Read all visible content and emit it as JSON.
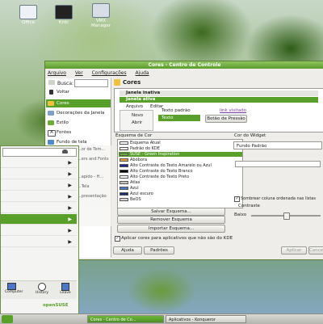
{
  "desktop": {
    "icons": [
      {
        "label": "Office",
        "icon": "office-icon"
      },
      {
        "label": "Krdc",
        "icon": "krdc-icon"
      },
      {
        "label": "VMX Manager",
        "icon": "vmx-manager-icon"
      }
    ]
  },
  "control_center": {
    "title": "Cores - Centro de Controle",
    "menu": [
      "Arquivo",
      "Ver",
      "Configurações",
      "Ajuda"
    ],
    "search_label": "Busca:",
    "search_value": "",
    "back_label": "Voltar",
    "sidebar": [
      {
        "label": "Cores",
        "icon": "palette-icon",
        "selected": true
      },
      {
        "label": "Decorações da Janela",
        "icon": "window-decoration-icon",
        "selected": false
      },
      {
        "label": "Estilo",
        "icon": "style-icon",
        "selected": false
      },
      {
        "label": "Fontes",
        "icon": "fonts-icon",
        "selected": false
      },
      {
        "label": "Fundo de tela",
        "icon": "wallpaper-icon",
        "selected": false
      }
    ],
    "section_title": "Cores",
    "preview": {
      "inactive_window": "Janela inativa",
      "active_window": "Janela ativa",
      "menu": [
        "Arquivo",
        "Editar"
      ],
      "menu_items": [
        "Novo",
        "Abrir"
      ],
      "normal_text": "Texto padrão",
      "visited_link": "link visitado",
      "selected_text": "Texto selecionado",
      "button": "Botão de Pressão"
    },
    "scheme_title": "Esquema de Cor",
    "schemes": [
      {
        "label": "Esquema Atual",
        "selected": false
      },
      {
        "label": "Padrão do KDE",
        "selected": false
      },
      {
        "label": "SUSE - Green Inspiration",
        "selected": true
      },
      {
        "label": "Abóbora",
        "selected": false
      },
      {
        "label": "Alto Contraste do Texto Amarelo ou Azul",
        "selected": false
      },
      {
        "label": "Alto Contraste do Texto Branco",
        "selected": false
      },
      {
        "label": "Alto Contraste do Texto Preto",
        "selected": false
      },
      {
        "label": "Atlas",
        "selected": false
      },
      {
        "label": "Azul",
        "selected": false
      },
      {
        "label": "Azul escuro",
        "selected": false
      },
      {
        "label": "BeOS",
        "selected": false
      }
    ],
    "buttons": [
      "Salvar Esquema...",
      "Remover Esquema",
      "Importar Esquema..."
    ],
    "widget_color_title": "Cor do Widget",
    "widget_color_value": "Fundo Padrão",
    "shade_checkbox": "Sombrear coluna ordenada nas listas",
    "contrast_title": "Contraste",
    "contrast_low": "Baixo",
    "contrast_level": 0.5,
    "apply_non_kde": "Aplicar cores para aplicativos que não são do KDE",
    "help_button": "Ajuda",
    "defaults_button": "Padrões",
    "apply_button": "Aplicar",
    "cancel_button": "Cancelar"
  },
  "background_window": {
    "items": [
      "...or de Tem...",
      "...ers and Fonts",
      "...apido - H...",
      "...Tela",
      "...presentação"
    ]
  },
  "start_menu": {
    "row_count": 8,
    "selected_row": 5,
    "tabs": [
      {
        "label": "Computer",
        "icon": "computer-icon"
      },
      {
        "label": "History",
        "icon": "history-icon"
      },
      {
        "label": "Leave",
        "icon": "leave-icon"
      }
    ],
    "brand": "openSUSE"
  },
  "taskbar": {
    "tasks": [
      "Cores - Centro de Co...",
      "Aplicativos - Konqueror"
    ]
  },
  "colors": {
    "accent": "#59a02b",
    "title_bar": "#5c9c2d"
  }
}
